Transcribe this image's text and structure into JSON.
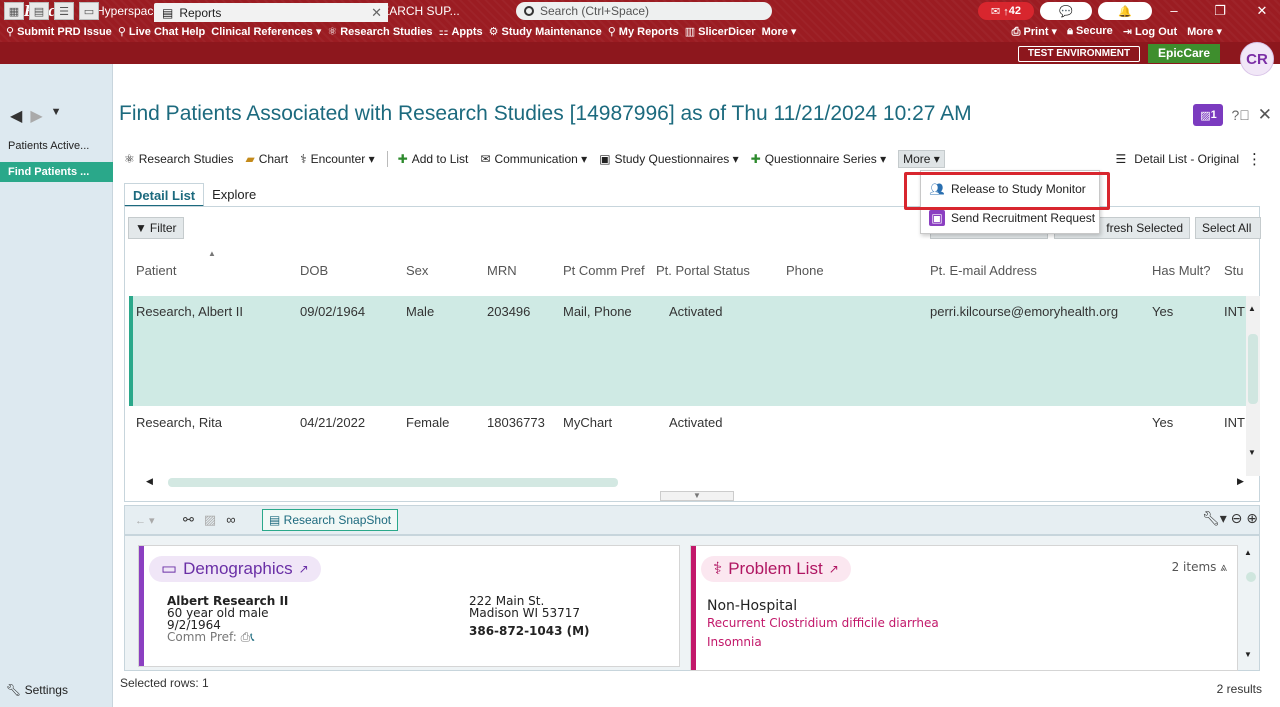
{
  "titlebar": {
    "logo": "Epic",
    "window_title": "Hyperspace TST – COORDINATOR R. – V EHC RESEARCH SUP...",
    "search_placeholder": "Search (Ctrl+Space)",
    "notification_count": "42"
  },
  "menu_bar": {
    "items": [
      "Submit PRD Issue",
      "Live Chat Help",
      "Clinical References ▾",
      "Research Studies",
      "Appts",
      "Study Maintenance",
      "My Reports",
      "SlicerDicer",
      "More ▾"
    ],
    "right_items": [
      "Print ▾",
      "Secure",
      "Log Out",
      "More ▾"
    ]
  },
  "user": {
    "initials": "CR"
  },
  "tabs": {
    "active_tab": "Reports",
    "environment": "TEST ENVIRONMENT",
    "app": "EpicCare"
  },
  "sidebar": {
    "items": [
      "Patients Active...",
      "Find Patients ..."
    ],
    "settings": "Settings"
  },
  "report": {
    "title": "Find Patients Associated with Research Studies [14987996] as of Thu 11/21/2024 10:27 AM",
    "badge": "1"
  },
  "toolbar": {
    "items": [
      "Research Studies",
      "Chart",
      "Encounter ▾",
      "Add to List",
      "Communication ▾",
      "Study Questionnaires ▾",
      "Questionnaire Series ▾",
      "More ▾"
    ],
    "view": "Detail List - Original"
  },
  "subtabs": [
    "Detail List",
    "Explore"
  ],
  "filter_label": "Filter",
  "buttons": {
    "refresh_selected": "fresh Selected",
    "select_all": "Select All"
  },
  "more_menu": {
    "items": [
      "Release to Study Monitor",
      "Send Recruitment Request"
    ]
  },
  "table": {
    "columns": [
      "Patient",
      "DOB",
      "Sex",
      "MRN",
      "Pt Comm Pref",
      "Pt. Portal Status",
      "Phone",
      "Pt. E-mail Address",
      "Has Mult?",
      "Stu"
    ],
    "rows": [
      [
        "Research, Albert II",
        "09/02/1964",
        "Male",
        "203496",
        "Mail, Phone",
        "Activated",
        "",
        "perri.kilcourse@emoryhealth.org",
        "Yes",
        "INT"
      ],
      [
        "Research, Rita",
        "04/21/2022",
        "Female",
        "18036773",
        "MyChart",
        "Activated",
        "",
        "",
        "Yes",
        "INT"
      ]
    ]
  },
  "snapshot": {
    "button": "Research SnapShot",
    "demographics": {
      "title": "Demographics",
      "name": "Albert Research II",
      "age_sex": "60 year old male",
      "dob": "9/2/1964",
      "comm_pref": "Comm Pref:",
      "address1": "222 Main St.",
      "address2": "Madison WI 53717",
      "phone": "386-872-1043 (M)"
    },
    "problem_list": {
      "title": "Problem List",
      "count": "2 items",
      "section": "Non-Hospital",
      "problems": [
        "Recurrent Clostridium difficile diarrhea",
        "Insomnia"
      ]
    }
  },
  "status": {
    "selected": "Selected rows: 1",
    "results": "2 results"
  }
}
